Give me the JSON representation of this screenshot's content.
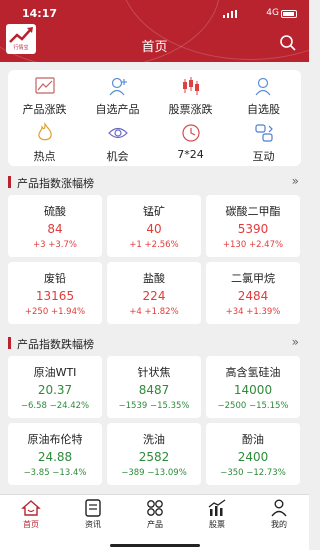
{
  "status": {
    "time": "14:17",
    "network": "4G"
  },
  "header": {
    "title": "首页",
    "logo_text": "行情宝"
  },
  "menu": [
    {
      "label": "产品涨跌",
      "icon": "line-chart-icon"
    },
    {
      "label": "自选产品",
      "icon": "user-plus-icon"
    },
    {
      "label": "股票涨跌",
      "icon": "candlestick-icon"
    },
    {
      "label": "自选股",
      "icon": "user-search-icon"
    },
    {
      "label": "热点",
      "icon": "flame-icon"
    },
    {
      "label": "机会",
      "icon": "eye-icon"
    },
    {
      "label": "7*24",
      "icon": "clock-icon"
    },
    {
      "label": "互动",
      "icon": "exchange-icon"
    }
  ],
  "rise_section": {
    "title": "产品指数涨幅榜",
    "items": [
      {
        "name": "硫酸",
        "price": "84",
        "change": "+3 +3.7%"
      },
      {
        "name": "锰矿",
        "price": "40",
        "change": "+1 +2.56%"
      },
      {
        "name": "碳酸二甲酯",
        "price": "5390",
        "change": "+130 +2.47%"
      },
      {
        "name": "废铅",
        "price": "13165",
        "change": "+250 +1.94%"
      },
      {
        "name": "盐酸",
        "price": "224",
        "change": "+4 +1.82%"
      },
      {
        "name": "二氯甲烷",
        "price": "2484",
        "change": "+34 +1.39%"
      }
    ]
  },
  "fall_section": {
    "title": "产品指数跌幅榜",
    "items": [
      {
        "name": "原油WTI",
        "price": "20.37",
        "change": "−6.58 −24.42%"
      },
      {
        "name": "针状焦",
        "price": "8487",
        "change": "−1539 −15.35%"
      },
      {
        "name": "高含氢硅油",
        "price": "14000",
        "change": "−2500 −15.15%"
      },
      {
        "name": "原油布伦特",
        "price": "24.88",
        "change": "−3.85 −13.4%"
      },
      {
        "name": "洗油",
        "price": "2582",
        "change": "−389 −13.09%"
      },
      {
        "name": "酚油",
        "price": "2400",
        "change": "−350 −12.73%"
      }
    ]
  },
  "tabbar": [
    {
      "label": "首页",
      "icon": "home-icon",
      "active": true
    },
    {
      "label": "资讯",
      "icon": "news-icon"
    },
    {
      "label": "产品",
      "icon": "grid-icon"
    },
    {
      "label": "股票",
      "icon": "stock-chart-icon"
    },
    {
      "label": "我的",
      "icon": "person-icon"
    }
  ],
  "colors": {
    "brand": "#b8232e",
    "up": "#e23b3b",
    "down": "#2e8b3a"
  }
}
